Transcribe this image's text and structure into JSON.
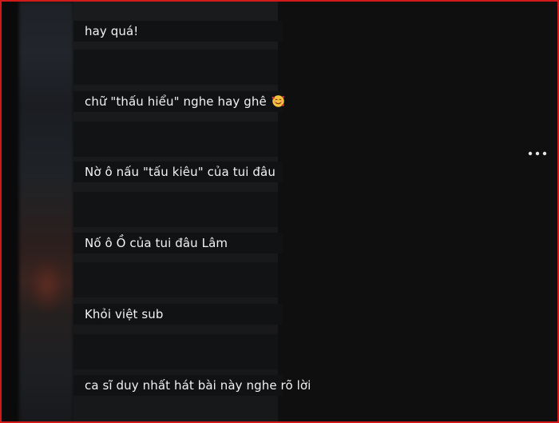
{
  "comments": [
    {
      "text": "hay quá!"
    },
    {
      "text": "chữ \"thấu hiểu\" nghe hay ghê"
    },
    {
      "text": "Nờ ô nấu \"tấu kiêu\" của tui đâu"
    },
    {
      "text": "Nố ô Ồ của tui đâu Lâm"
    },
    {
      "text": "Khỏi việt sub"
    },
    {
      "text": "ca sĩ duy nhất hát bài này nghe rõ lời"
    }
  ],
  "icons": {
    "emoji": "smiling-face-with-hearts-icon",
    "more": "more-options-icon"
  },
  "colors": {
    "frame_border": "#d21a1a",
    "background": "#0d0d0e",
    "text": "#f2f2f2"
  }
}
